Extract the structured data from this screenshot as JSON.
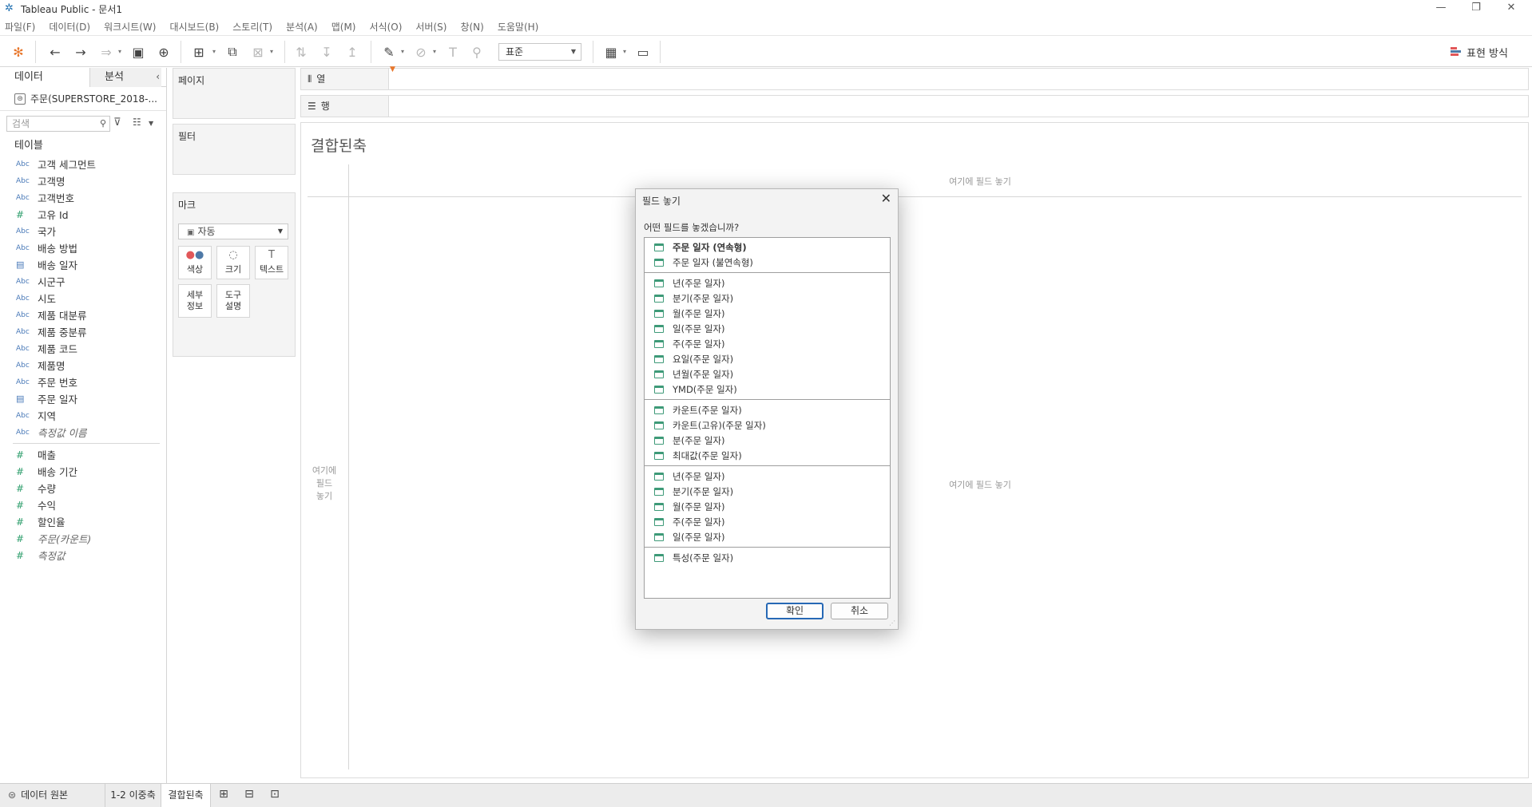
{
  "window": {
    "title": "Tableau Public - 문서1",
    "minimize": "—",
    "restore": "❐",
    "close": "✕"
  },
  "menu": [
    "파일(F)",
    "데이터(D)",
    "워크시트(W)",
    "대시보드(B)",
    "스토리(T)",
    "분석(A)",
    "맵(M)",
    "서식(O)",
    "서버(S)",
    "창(N)",
    "도움말(H)"
  ],
  "toolbar": {
    "fit_value": "표준",
    "show_me_label": "표현 방식"
  },
  "data_pane": {
    "tab_data": "데이터",
    "tab_analysis": "분석",
    "datasource": "주문(SUPERSTORE_2018-...",
    "search_placeholder": "검색",
    "tables_heading": "테이블",
    "dimensions": [
      {
        "type": "Abc",
        "name": "고객 세그먼트"
      },
      {
        "type": "Abc",
        "name": "고객명"
      },
      {
        "type": "Abc",
        "name": "고객번호"
      },
      {
        "type": "#",
        "name": "고유 Id"
      },
      {
        "type": "Abc",
        "name": "국가"
      },
      {
        "type": "Abc",
        "name": "배송 방법"
      },
      {
        "type": "date",
        "name": "배송 일자"
      },
      {
        "type": "Abc",
        "name": "시군구"
      },
      {
        "type": "Abc",
        "name": "시도"
      },
      {
        "type": "Abc",
        "name": "제품 대분류"
      },
      {
        "type": "Abc",
        "name": "제품 중분류"
      },
      {
        "type": "Abc",
        "name": "제품 코드"
      },
      {
        "type": "Abc",
        "name": "제품명"
      },
      {
        "type": "Abc",
        "name": "주문 번호"
      },
      {
        "type": "date",
        "name": "주문 일자"
      },
      {
        "type": "Abc",
        "name": "지역"
      },
      {
        "type": "Abc",
        "name": "측정값 이름",
        "italic": true
      }
    ],
    "measures": [
      {
        "type": "#",
        "name": "매출"
      },
      {
        "type": "#",
        "name": "배송 기간"
      },
      {
        "type": "#",
        "name": "수량"
      },
      {
        "type": "#",
        "name": "수익"
      },
      {
        "type": "#",
        "name": "할인율"
      },
      {
        "type": "#",
        "name": "주문(카운트)",
        "italic": true
      },
      {
        "type": "#",
        "name": "측정값",
        "italic": true
      }
    ]
  },
  "cards": {
    "pages": "페이지",
    "filters": "필터",
    "marks": "마크",
    "marks_type": "자동",
    "color": "색상",
    "size": "크기",
    "text": "텍스트",
    "detail_line1": "세부",
    "detail_line2": "정보",
    "tooltip_line1": "도구",
    "tooltip_line2": "설명"
  },
  "shelves": {
    "columns": "열",
    "rows": "행"
  },
  "view": {
    "sheet_title": "결합된축",
    "drop_top": "여기에 필드 놓기",
    "drop_center": "여기에 필드 놓기",
    "drop_left_1": "여기에",
    "drop_left_2": "필드",
    "drop_left_3": "놓기"
  },
  "dialog": {
    "title": "필드 놓기",
    "question": "어떤 필드를 놓겠습니까?",
    "groups": [
      [
        "주문 일자 (연속형)",
        "주문 일자 (불연속형)"
      ],
      [
        "년(주문 일자)",
        "분기(주문 일자)",
        "월(주문 일자)",
        "일(주문 일자)",
        "주(주문 일자)",
        "요일(주문 일자)",
        "년월(주문 일자)",
        "YMD(주문 일자)"
      ],
      [
        "카운트(주문 일자)",
        "카운트(고유)(주문 일자)",
        "분(주문 일자)",
        "최대값(주문 일자)"
      ],
      [
        "년(주문 일자)",
        "분기(주문 일자)",
        "월(주문 일자)",
        "주(주문 일자)",
        "일(주문 일자)"
      ],
      [
        "특성(주문 일자)"
      ]
    ],
    "ok": "확인",
    "cancel": "취소"
  },
  "bottom_tabs": {
    "data_source": "데이터 원본",
    "sheet1": "1-2 이중축",
    "sheet2": "결합된축"
  },
  "colors": {
    "accent_blue": "#2668b5",
    "date_green": "#3e9a78",
    "measure_green": "#2e9e6c",
    "dimension_blue": "#4a7ab8"
  }
}
